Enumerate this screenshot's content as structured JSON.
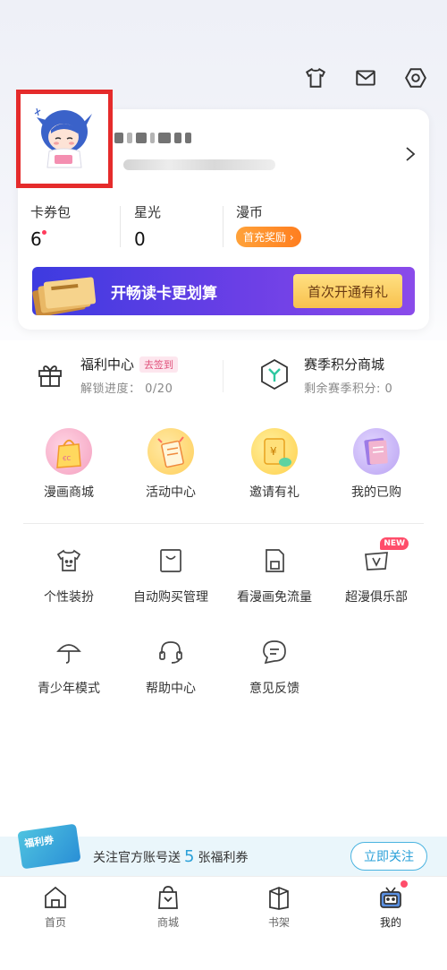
{
  "header": {
    "icons": [
      "shirt-icon",
      "mail-icon",
      "settings-icon"
    ]
  },
  "profile": {
    "stats": [
      {
        "label": "卡券包",
        "value": "6"
      },
      {
        "label": "星光",
        "value": "0"
      },
      {
        "label": "漫币",
        "value": "首充奖励 ›"
      }
    ],
    "vip_banner_text": "开畅读卡更划算",
    "vip_banner_button": "首次开通有礼"
  },
  "welfare": {
    "left_title": "福利中心",
    "left_tag": "去签到",
    "left_sub_label": "解锁进度：",
    "left_sub_value": "0/20",
    "right_title": "赛季积分商城",
    "right_sub": "剩余赛季积分: 0"
  },
  "grid1": [
    {
      "label": "漫画商城",
      "icon": "shopping-bag-icon"
    },
    {
      "label": "活动中心",
      "icon": "activity-icon"
    },
    {
      "label": "邀请有礼",
      "icon": "invite-icon"
    },
    {
      "label": "我的已购",
      "icon": "purchased-book-icon"
    }
  ],
  "grid2": [
    {
      "label": "个性装扮",
      "icon": "shirt-icon"
    },
    {
      "label": "自动购买管理",
      "icon": "auto-buy-icon"
    },
    {
      "label": "看漫画免流量",
      "icon": "sim-card-icon"
    },
    {
      "label": "超漫俱乐部",
      "icon": "vip-club-icon",
      "badge": "NEW"
    }
  ],
  "grid3": [
    {
      "label": "青少年模式",
      "icon": "umbrella-icon"
    },
    {
      "label": "帮助中心",
      "icon": "headset-icon"
    },
    {
      "label": "意见反馈",
      "icon": "feedback-icon"
    }
  ],
  "promo": {
    "card_text": "福利券",
    "text_before": "关注官方账号送",
    "number": "5",
    "text_after": "张福利券",
    "button": "立即关注"
  },
  "tabbar": [
    {
      "label": "首页",
      "icon": "home-icon"
    },
    {
      "label": "商城",
      "icon": "store-icon"
    },
    {
      "label": "书架",
      "icon": "bookshelf-icon"
    },
    {
      "label": "我的",
      "icon": "profile-tv-icon",
      "active": true
    }
  ]
}
